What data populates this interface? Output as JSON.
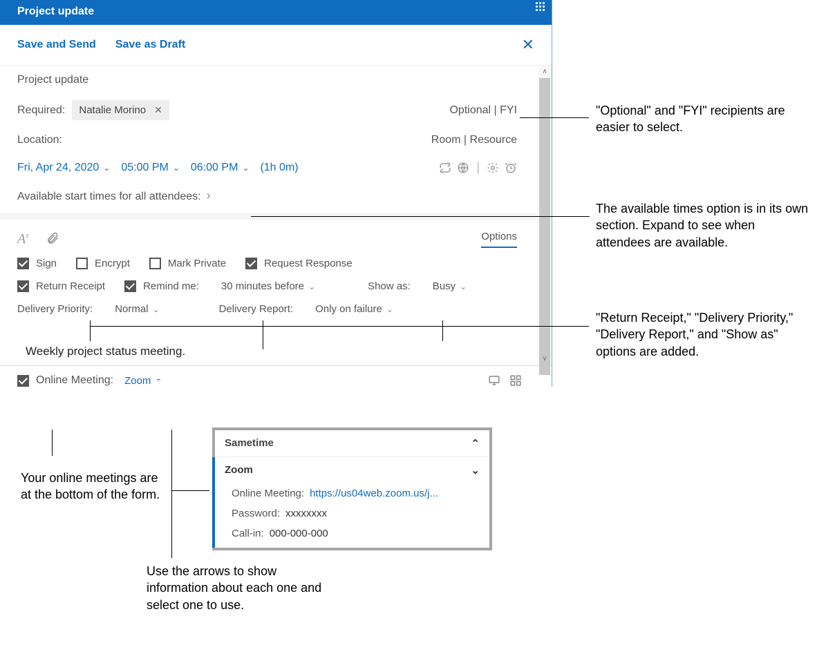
{
  "window": {
    "title": "Project update"
  },
  "actions": {
    "save_send": "Save and Send",
    "save_draft": "Save as Draft"
  },
  "subject": "Project update",
  "required_label": "Required:",
  "recipient": "Natalie Morino",
  "optional_fyi": "Optional | FYI",
  "location_label": "Location:",
  "room_resource": "Room | Resource",
  "datetime": {
    "date": "Fri, Apr 24, 2020",
    "start": "05:00 PM",
    "end": "06:00 PM",
    "duration": "(1h 0m)"
  },
  "available_times": "Available start times for all attendees:",
  "options_tab": "Options",
  "checkboxes": {
    "sign": "Sign",
    "encrypt": "Encrypt",
    "mark_private": "Mark Private",
    "request_response": "Request Response",
    "return_receipt": "Return Receipt",
    "remind_me": "Remind me:"
  },
  "remind_value": "30 minutes before",
  "show_as_label": "Show as:",
  "show_as_value": "Busy",
  "delivery_priority_label": "Delivery Priority:",
  "delivery_priority_value": "Normal",
  "delivery_report_label": "Delivery Report:",
  "delivery_report_value": "Only on failure",
  "body": "Weekly project status meeting.",
  "online_meeting_label": "Online Meeting:",
  "online_meeting_value": "Zoom",
  "meeting_panel": {
    "sametime": "Sametime",
    "zoom": "Zoom",
    "fields": {
      "url_label": "Online Meeting:",
      "url_value": "https://us04web.zoom.us/j...",
      "password_label": "Password:",
      "password_value": "xxxxxxxx",
      "callin_label": "Call-in:",
      "callin_value": "000-000-000"
    }
  },
  "annots": {
    "a1": "\"Optional\" and \"FYI\" recipients are easier to select.",
    "a2": "The available times option is in its own section. Expand to see when attendees are available.",
    "a3": "\"Return Receipt,\" \"Delivery Priority,\" \"Delivery Report,\" and \"Show as\" options are added.",
    "a4": "Your online meetings are at the bottom of the form.",
    "a5": "Use the arrows to show information about each one and select one to use."
  }
}
